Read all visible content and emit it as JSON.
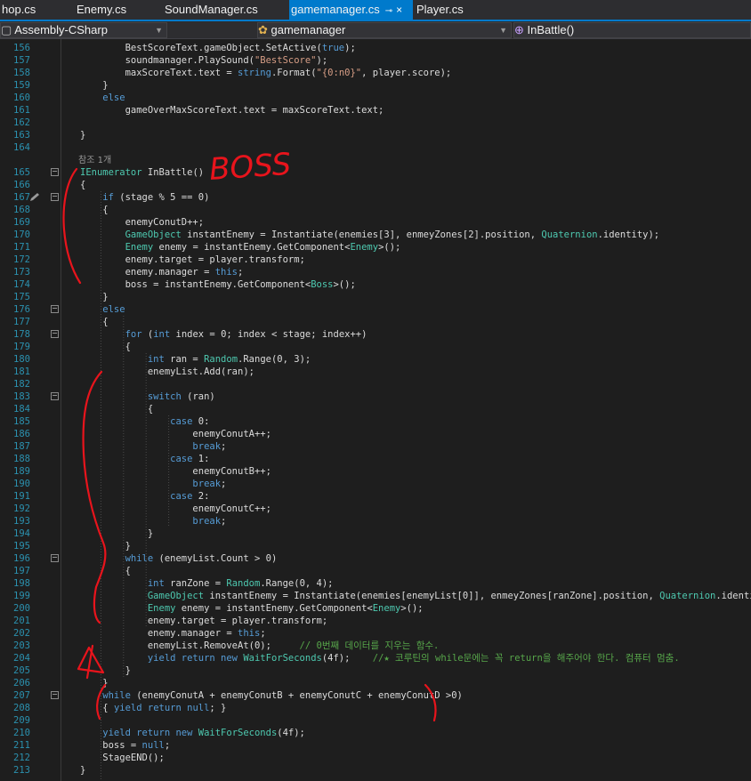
{
  "tabs": [
    {
      "label": "hop.cs",
      "active": false
    },
    {
      "label": "Enemy.cs",
      "active": false
    },
    {
      "label": "SoundManager.cs",
      "active": false
    },
    {
      "label": "gamemanager.cs",
      "active": true,
      "pin": "⊸",
      "close": "×"
    },
    {
      "label": "Player.cs",
      "active": false
    }
  ],
  "navbar": {
    "project": "Assembly-CSharp",
    "class": "gamemanager",
    "member": "InBattle()",
    "class_icon": "class-icon",
    "member_icon": "method-icon"
  },
  "annotation": {
    "boss_text": "BOSS",
    "color": "#e8141c"
  },
  "colors": {
    "keyword": "#569cd6",
    "type": "#4ec9b0",
    "string": "#d69d85",
    "comment": "#57a64a",
    "line_number": "#2b91af",
    "tab_active": "#007acc"
  },
  "lines": [
    {
      "n": "156",
      "i": 0,
      "t": [
        [
          "pl",
          "        BestScoreText.gameObject.SetActive("
        ],
        [
          "kw",
          "true"
        ],
        [
          "pl",
          ");"
        ]
      ]
    },
    {
      "n": "157",
      "i": 0,
      "t": [
        [
          "pl",
          "        soundmanager.PlaySound("
        ],
        [
          "st",
          "\"BestScore\""
        ],
        [
          "pl",
          ");"
        ]
      ]
    },
    {
      "n": "158",
      "i": 0,
      "t": [
        [
          "pl",
          "        maxScoreText.text = "
        ],
        [
          "kw",
          "string"
        ],
        [
          "pl",
          ".Format("
        ],
        [
          "st",
          "\"{0:n0}\""
        ],
        [
          "pl",
          ", player.score);"
        ]
      ]
    },
    {
      "n": "159",
      "i": 0,
      "t": [
        [
          "pl",
          "    }"
        ]
      ]
    },
    {
      "n": "160",
      "i": 0,
      "t": [
        [
          "kw",
          "    else"
        ]
      ]
    },
    {
      "n": "161",
      "i": 0,
      "t": [
        [
          "pl",
          "        gameOverMaxScoreText.text = maxScoreText.text;"
        ]
      ]
    },
    {
      "n": "162",
      "i": 0,
      "t": [
        [
          "pl",
          ""
        ]
      ]
    },
    {
      "n": "163",
      "i": 0,
      "t": [
        [
          "pl",
          "}"
        ]
      ]
    },
    {
      "n": "164",
      "i": 0,
      "t": [
        [
          "pl",
          ""
        ]
      ]
    },
    {
      "n": "",
      "i": 0,
      "ref": true,
      "t": [
        [
          "ref",
          "참조 1개"
        ]
      ]
    },
    {
      "n": "165",
      "i": 0,
      "fold": "−",
      "t": [
        [
          "ty",
          "IEnumerator"
        ],
        [
          "pl",
          " InBattle()"
        ]
      ]
    },
    {
      "n": "166",
      "i": 0,
      "t": [
        [
          "pl",
          "{"
        ]
      ]
    },
    {
      "n": "167",
      "i": 0,
      "fold": "−",
      "pencil": true,
      "t": [
        [
          "kw",
          "    if"
        ],
        [
          "pl",
          " (stage % 5 == 0)"
        ]
      ]
    },
    {
      "n": "168",
      "i": 0,
      "t": [
        [
          "pl",
          "    {"
        ]
      ]
    },
    {
      "n": "169",
      "i": 0,
      "t": [
        [
          "pl",
          "        enemyConutD++;"
        ]
      ]
    },
    {
      "n": "170",
      "i": 0,
      "t": [
        [
          "ty",
          "        GameObject"
        ],
        [
          "pl",
          " instantEnemy = Instantiate(enemies[3], enmeyZones[2].position, "
        ],
        [
          "ty",
          "Quaternion"
        ],
        [
          "pl",
          ".identity);"
        ]
      ]
    },
    {
      "n": "171",
      "i": 0,
      "t": [
        [
          "ty",
          "        Enemy"
        ],
        [
          "pl",
          " enemy = instantEnemy.GetComponent<"
        ],
        [
          "ty",
          "Enemy"
        ],
        [
          "pl",
          ">();"
        ]
      ]
    },
    {
      "n": "172",
      "i": 0,
      "t": [
        [
          "pl",
          "        enemy.target = player.transform;"
        ]
      ]
    },
    {
      "n": "173",
      "i": 0,
      "t": [
        [
          "pl",
          "        enemy.manager = "
        ],
        [
          "kw",
          "this"
        ],
        [
          "pl",
          ";"
        ]
      ]
    },
    {
      "n": "174",
      "i": 0,
      "t": [
        [
          "pl",
          "        boss = instantEnemy.GetComponent<"
        ],
        [
          "ty",
          "Boss"
        ],
        [
          "pl",
          ">();"
        ]
      ]
    },
    {
      "n": "175",
      "i": 0,
      "t": [
        [
          "pl",
          "    }"
        ]
      ]
    },
    {
      "n": "176",
      "i": 0,
      "fold": "−",
      "t": [
        [
          "kw",
          "    else"
        ]
      ]
    },
    {
      "n": "177",
      "i": 0,
      "t": [
        [
          "pl",
          "    {"
        ]
      ]
    },
    {
      "n": "178",
      "i": 0,
      "fold": "−",
      "t": [
        [
          "kw",
          "        for"
        ],
        [
          "pl",
          " ("
        ],
        [
          "kw",
          "int"
        ],
        [
          "pl",
          " index = 0; index < stage; index++)"
        ]
      ]
    },
    {
      "n": "179",
      "i": 0,
      "t": [
        [
          "pl",
          "        {"
        ]
      ]
    },
    {
      "n": "180",
      "i": 0,
      "t": [
        [
          "kw",
          "            int"
        ],
        [
          "pl",
          " ran = "
        ],
        [
          "ty",
          "Random"
        ],
        [
          "pl",
          ".Range(0, 3);"
        ]
      ]
    },
    {
      "n": "181",
      "i": 0,
      "t": [
        [
          "pl",
          "            enemyList.Add(ran);"
        ]
      ]
    },
    {
      "n": "182",
      "i": 0,
      "t": [
        [
          "pl",
          ""
        ]
      ]
    },
    {
      "n": "183",
      "i": 0,
      "fold": "−",
      "t": [
        [
          "kw",
          "            switch"
        ],
        [
          "pl",
          " (ran)"
        ]
      ]
    },
    {
      "n": "184",
      "i": 0,
      "t": [
        [
          "pl",
          "            {"
        ]
      ]
    },
    {
      "n": "185",
      "i": 0,
      "t": [
        [
          "kw",
          "                case"
        ],
        [
          "pl",
          " 0:"
        ]
      ]
    },
    {
      "n": "186",
      "i": 0,
      "t": [
        [
          "pl",
          "                    enemyConutA++;"
        ]
      ]
    },
    {
      "n": "187",
      "i": 0,
      "t": [
        [
          "kw",
          "                    break"
        ],
        [
          "pl",
          ";"
        ]
      ]
    },
    {
      "n": "188",
      "i": 0,
      "t": [
        [
          "kw",
          "                case"
        ],
        [
          "pl",
          " 1:"
        ]
      ]
    },
    {
      "n": "189",
      "i": 0,
      "t": [
        [
          "pl",
          "                    enemyConutB++;"
        ]
      ]
    },
    {
      "n": "190",
      "i": 0,
      "t": [
        [
          "kw",
          "                    break"
        ],
        [
          "pl",
          ";"
        ]
      ]
    },
    {
      "n": "191",
      "i": 0,
      "t": [
        [
          "kw",
          "                case"
        ],
        [
          "pl",
          " 2:"
        ]
      ]
    },
    {
      "n": "192",
      "i": 0,
      "t": [
        [
          "pl",
          "                    enemyConutC++;"
        ]
      ]
    },
    {
      "n": "193",
      "i": 0,
      "t": [
        [
          "kw",
          "                    break"
        ],
        [
          "pl",
          ";"
        ]
      ]
    },
    {
      "n": "194",
      "i": 0,
      "t": [
        [
          "pl",
          "            }"
        ]
      ]
    },
    {
      "n": "195",
      "i": 0,
      "t": [
        [
          "pl",
          "        }"
        ]
      ]
    },
    {
      "n": "196",
      "i": 0,
      "fold": "−",
      "t": [
        [
          "kw",
          "        while"
        ],
        [
          "pl",
          " (enemyList.Count > 0)"
        ]
      ]
    },
    {
      "n": "197",
      "i": 0,
      "t": [
        [
          "pl",
          "        {"
        ]
      ]
    },
    {
      "n": "198",
      "i": 0,
      "t": [
        [
          "kw",
          "            int"
        ],
        [
          "pl",
          " ranZone = "
        ],
        [
          "ty",
          "Random"
        ],
        [
          "pl",
          ".Range(0, 4);"
        ]
      ]
    },
    {
      "n": "199",
      "i": 0,
      "t": [
        [
          "ty",
          "            GameObject"
        ],
        [
          "pl",
          " instantEnemy = Instantiate(enemies[enemyList[0]], enmeyZones[ranZone].position, "
        ],
        [
          "ty",
          "Quaternion"
        ],
        [
          "pl",
          ".identity);"
        ]
      ]
    },
    {
      "n": "200",
      "i": 0,
      "t": [
        [
          "ty",
          "            Enemy"
        ],
        [
          "pl",
          " enemy = instantEnemy.GetComponent<"
        ],
        [
          "ty",
          "Enemy"
        ],
        [
          "pl",
          ">();"
        ]
      ]
    },
    {
      "n": "201",
      "i": 0,
      "t": [
        [
          "pl",
          "            enemy.target = player.transform;"
        ]
      ]
    },
    {
      "n": "202",
      "i": 0,
      "t": [
        [
          "pl",
          "            enemy.manager = "
        ],
        [
          "kw",
          "this"
        ],
        [
          "pl",
          ";"
        ]
      ]
    },
    {
      "n": "203",
      "i": 0,
      "t": [
        [
          "pl",
          "            enemyList.RemoveAt(0);     "
        ],
        [
          "cm",
          "// 0번째 데이터를 지우는 함수."
        ]
      ]
    },
    {
      "n": "204",
      "i": 0,
      "t": [
        [
          "kw",
          "            yield return new"
        ],
        [
          "ty",
          " WaitForSeconds"
        ],
        [
          "pl",
          "(4f);    "
        ],
        [
          "cm",
          "//★ 코루틴의 while문에는 꼭 return을 해주어야 한다. 컴퓨터 멈춤."
        ]
      ]
    },
    {
      "n": "205",
      "i": 0,
      "t": [
        [
          "pl",
          "        }"
        ]
      ]
    },
    {
      "n": "206",
      "i": 0,
      "t": [
        [
          "pl",
          "    }"
        ]
      ]
    },
    {
      "n": "207",
      "i": 0,
      "fold": "−",
      "t": [
        [
          "kw",
          "    while"
        ],
        [
          "pl",
          " (enemyConutA + enemyConutB + enemyConutC + enemyConutD >0)"
        ]
      ]
    },
    {
      "n": "208",
      "i": 0,
      "t": [
        [
          "pl",
          "    { "
        ],
        [
          "kw",
          "yield return null"
        ],
        [
          "pl",
          "; }"
        ]
      ]
    },
    {
      "n": "209",
      "i": 0,
      "t": [
        [
          "pl",
          ""
        ]
      ]
    },
    {
      "n": "210",
      "i": 0,
      "t": [
        [
          "kw",
          "    yield return new"
        ],
        [
          "ty",
          " WaitForSeconds"
        ],
        [
          "pl",
          "(4f);"
        ]
      ]
    },
    {
      "n": "211",
      "i": 0,
      "t": [
        [
          "pl",
          "    boss = "
        ],
        [
          "kw",
          "null"
        ],
        [
          "pl",
          ";"
        ]
      ]
    },
    {
      "n": "212",
      "i": 0,
      "t": [
        [
          "pl",
          "    StageEND();"
        ]
      ]
    },
    {
      "n": "213",
      "i": 0,
      "t": [
        [
          "pl",
          "}"
        ]
      ]
    }
  ]
}
